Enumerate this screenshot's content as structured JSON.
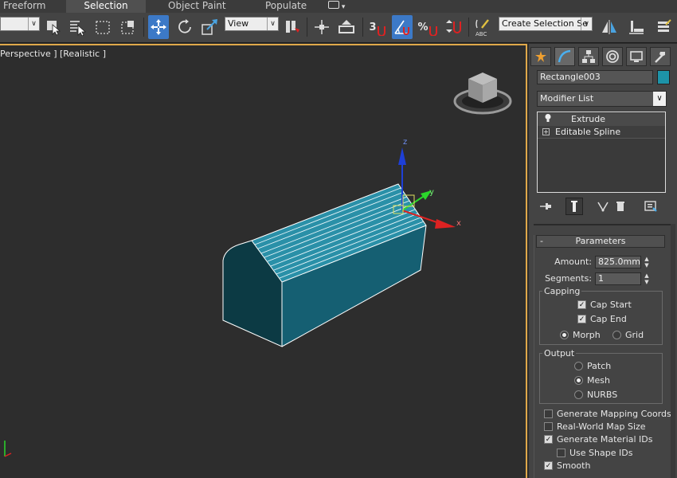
{
  "ribbon": {
    "tabs": [
      {
        "label": "Freeform",
        "active": false
      },
      {
        "label": "Selection",
        "active": true
      },
      {
        "label": "Object Paint",
        "active": false
      },
      {
        "label": "Populate",
        "active": false
      }
    ]
  },
  "toolbar": {
    "reference_coord": "View",
    "snap_number": "3",
    "named_selection_placeholder": "Create Selection Se",
    "percent_symbol": "%"
  },
  "viewport": {
    "label": "[+] [Perspective ] [Realistic ]",
    "label_visible": "Perspective ] [Realistic ]",
    "gizmo": {
      "z": "z",
      "y": "y",
      "x": "x"
    },
    "object_color": "#1d6e80"
  },
  "command_panel": {
    "object_name": "Rectangle003",
    "object_color": "#1d93a8",
    "modifier_list": "Modifier List",
    "stack": [
      "Extrude",
      "Editable Spline"
    ],
    "parameters": {
      "title": "Parameters",
      "amount_label": "Amount:",
      "amount_value": "825.0mm",
      "segments_label": "Segments:",
      "segments_value": "1",
      "capping": {
        "title": "Capping",
        "cap_start": "Cap Start",
        "cap_end": "Cap End",
        "morph": "Morph",
        "grid": "Grid"
      },
      "output": {
        "title": "Output",
        "patch": "Patch",
        "mesh": "Mesh",
        "nurbs": "NURBS"
      },
      "generate_mapping": "Generate Mapping Coords.",
      "real_world": "Real-World Map Size",
      "generate_material_ids": "Generate Material IDs",
      "use_shape_ids": "Use Shape IDs",
      "smooth": "Smooth"
    }
  }
}
